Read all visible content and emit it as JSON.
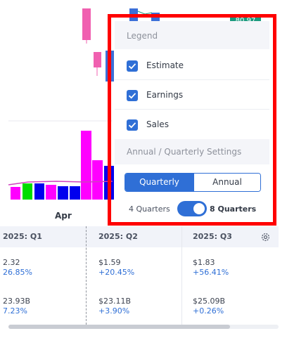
{
  "colors": {
    "accent": "#2f6fd6",
    "highlight_frame": "#ff0000",
    "price_tag_bg": "#1a9a7e",
    "bar_magenta": "#ff00ff",
    "bar_blue": "#0000ee",
    "bar_green": "#00dd00",
    "candle_pink": "#f060b0",
    "candle_blue": "#3b6fd8",
    "ma_line": "#d040c0"
  },
  "chart": {
    "price_tag": "80.97",
    "x_axis_label": "Apr"
  },
  "financials": {
    "columns": [
      {
        "quarter": "2025: Q1",
        "eps": "2.32",
        "eps_change": "26.85%",
        "revenue": "23.93B",
        "revenue_change": "7.23%"
      },
      {
        "quarter": "2025: Q2",
        "eps": "$1.59",
        "eps_change": "+20.45%",
        "revenue": "$23.11B",
        "revenue_change": "+3.90%"
      },
      {
        "quarter": "2025: Q3",
        "eps": "$1.83",
        "eps_change": "+56.41%",
        "revenue": "$25.09B",
        "revenue_change": "+0.26%"
      }
    ],
    "settings_icon": "gear-icon"
  },
  "legend_panel": {
    "title": "Legend",
    "items": [
      {
        "label": "Estimate",
        "checked": true
      },
      {
        "label": "Earnings",
        "checked": true
      },
      {
        "label": "Sales",
        "checked": true
      }
    ],
    "settings_title": "Annual / Quarterly Settings",
    "period_toggle": {
      "options": [
        "Quarterly",
        "Annual"
      ],
      "selected": "Quarterly"
    },
    "quarters_switch": {
      "left_label": "4 Quarters",
      "right_label": "8 Quarters",
      "selected": "8 Quarters"
    }
  }
}
